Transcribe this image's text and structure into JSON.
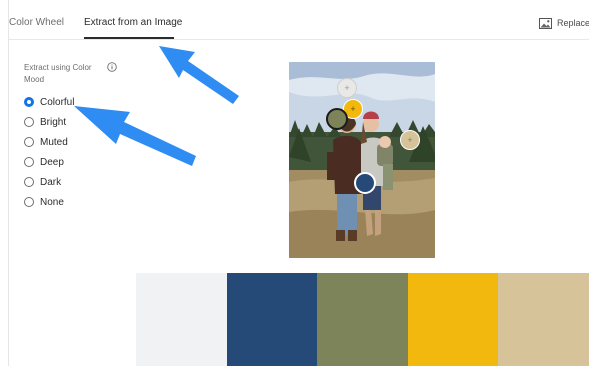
{
  "tabs": [
    {
      "label": "Color Wheel",
      "active": false
    },
    {
      "label": "Extract from an Image",
      "active": true
    }
  ],
  "replace_label": "Replace",
  "mood": {
    "heading": "Extract using Color Mood",
    "options": [
      {
        "label": "Colorful",
        "checked": true
      },
      {
        "label": "Bright",
        "checked": false
      },
      {
        "label": "Muted",
        "checked": false
      },
      {
        "label": "Deep",
        "checked": false
      },
      {
        "label": "Dark",
        "checked": false
      },
      {
        "label": "None",
        "checked": false
      }
    ]
  },
  "pickers": [
    {
      "color": "#e8e8e6",
      "symbol": "+"
    },
    {
      "color": "#f2b80d",
      "symbol": "+"
    },
    {
      "color": "#7d845a",
      "symbol": ""
    },
    {
      "color": "#d7c39a",
      "symbol": "+"
    },
    {
      "color": "#254a78",
      "symbol": ""
    }
  ],
  "swatches": [
    {
      "color": "#f1f2f4"
    },
    {
      "color": "#254a78"
    },
    {
      "color": "#7d845a"
    },
    {
      "color": "#f2b80d"
    },
    {
      "color": "#d7c39a"
    }
  ],
  "accent_color": "#1473e6",
  "annotation_arrow_color": "#2f8cf2"
}
